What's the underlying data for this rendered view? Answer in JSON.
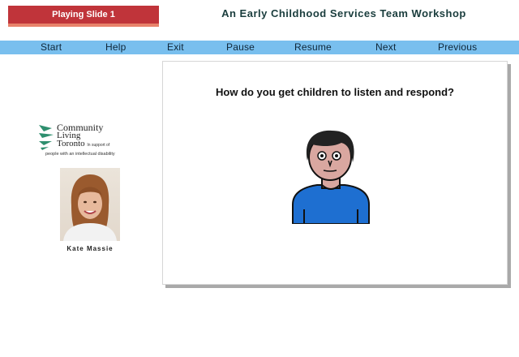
{
  "status": {
    "text": "Playing Slide 1"
  },
  "header": {
    "title": "An Early Childhood Services Team Workshop"
  },
  "nav": {
    "start": "Start",
    "help": "Help",
    "exit": "Exit",
    "pause": "Pause",
    "resume": "Resume",
    "next": "Next",
    "previous": "Previous"
  },
  "logo": {
    "line1": "Community",
    "line2": "Living",
    "line3": "Toronto",
    "line3_small": "In support of",
    "tagline": "people with an intellectual disability"
  },
  "presenter": {
    "name": "Kate Massie"
  },
  "slide": {
    "question": "How do you get children to listen and respond?"
  },
  "colors": {
    "status_bar": "#c0343a",
    "nav_bar": "#79bfee",
    "title_text": "#1a3d3d",
    "logo_green": "#2e8f6e"
  }
}
